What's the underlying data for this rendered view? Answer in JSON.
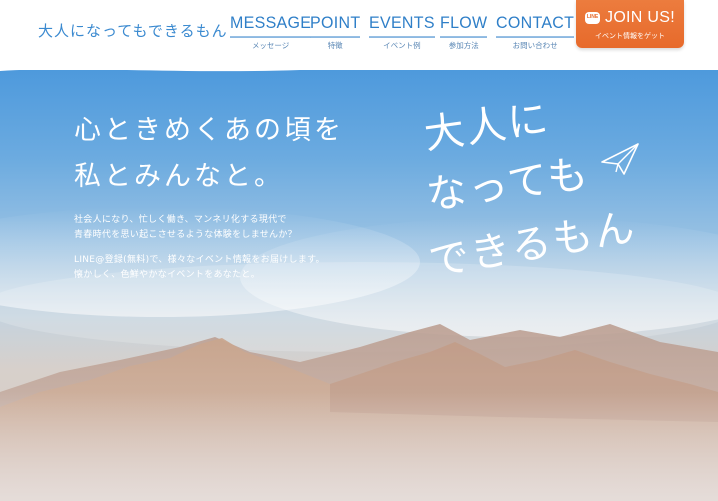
{
  "site": {
    "logo": "大人になってもできるもん"
  },
  "nav": [
    {
      "label": "MESSAGE",
      "sub": "メッセージ"
    },
    {
      "label": "POINT",
      "sub": "特徴"
    },
    {
      "label": "EVENTS",
      "sub": "イベント例"
    },
    {
      "label": "FLOW",
      "sub": "参加方法"
    },
    {
      "label": "CONTACT",
      "sub": "お問い合わせ"
    }
  ],
  "join": {
    "label": "JOIN US!",
    "sub": "イベント情報をゲット",
    "icon": "line-icon",
    "icon_text": "LINE"
  },
  "hero": {
    "tagline": "心ときめくあの頃を\n私とみんなと。",
    "desc1": "社会人になり、忙しく働き、マンネリ化する現代で\n青春時代を思い起こさせるような体験をしませんか？",
    "desc2": "LINE@登録(無料)で、様々なイベント情報をお届けします。\n懐かしく、色鮮やかなイベントをあなたと。",
    "title_lines": [
      "大人に",
      "なっても",
      "できるもん"
    ]
  },
  "colors": {
    "brand_blue": "#2f7fc8",
    "join_orange": "#e76a2b"
  }
}
